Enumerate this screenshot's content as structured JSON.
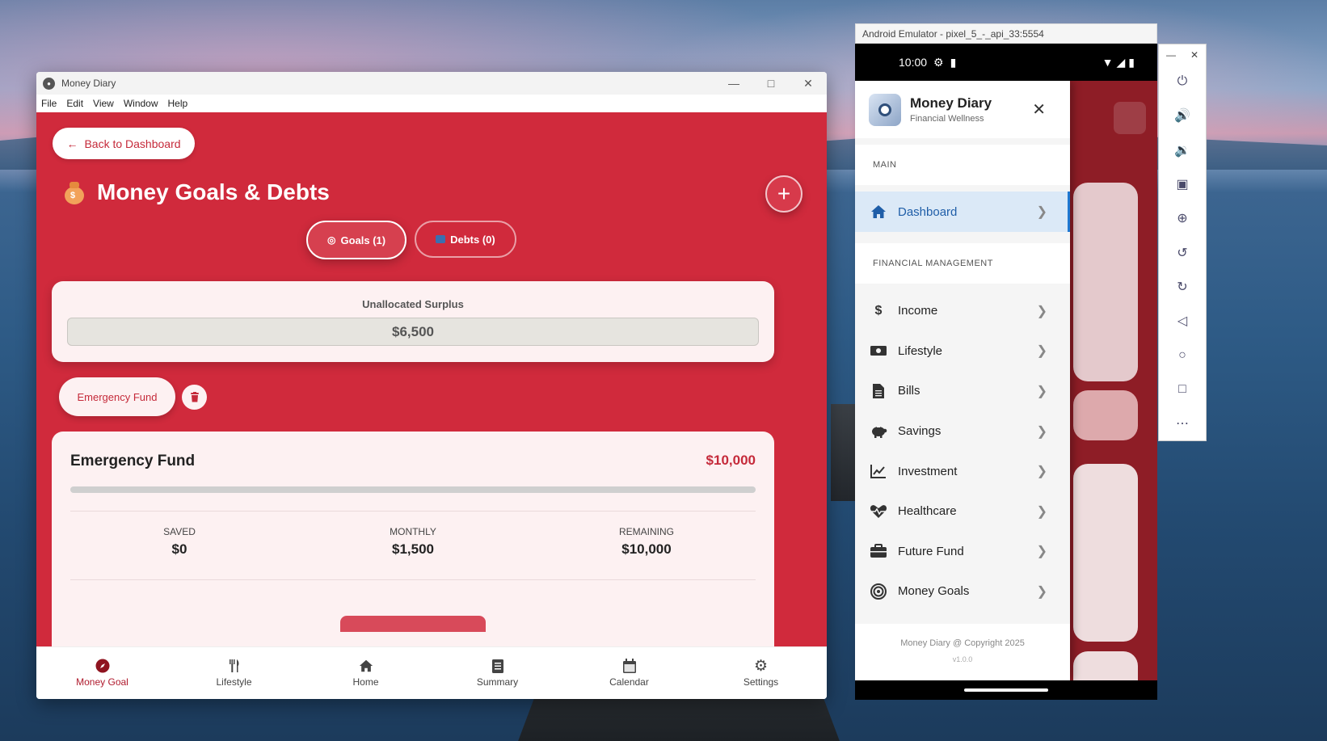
{
  "window": {
    "title": "Money Diary",
    "menu": [
      "File",
      "Edit",
      "View",
      "Window",
      "Help"
    ]
  },
  "page": {
    "back_label": "Back to Dashboard",
    "title": "Money Goals & Debts",
    "tabs": [
      {
        "label": "Goals (1)",
        "active": true,
        "icon": "target-icon"
      },
      {
        "label": "Debts (0)",
        "active": false,
        "icon": "credit-card-icon"
      }
    ],
    "surplus_label": "Unallocated Surplus",
    "surplus_value": "$6,500",
    "goal_chip": "Emergency Fund",
    "goal": {
      "name": "Emergency Fund",
      "target": "$10,000",
      "progress": 0,
      "stats": [
        {
          "label": "SAVED",
          "value": "$0"
        },
        {
          "label": "MONTHLY",
          "value": "$1,500"
        },
        {
          "label": "REMAINING",
          "value": "$10,000"
        }
      ]
    }
  },
  "bottom_nav": [
    {
      "label": "Money Goal",
      "icon": "compass-icon",
      "active": true
    },
    {
      "label": "Lifestyle",
      "icon": "utensils-icon",
      "active": false
    },
    {
      "label": "Home",
      "icon": "home-icon",
      "active": false
    },
    {
      "label": "Summary",
      "icon": "clipboard-icon",
      "active": false
    },
    {
      "label": "Calendar",
      "icon": "calendar-icon",
      "active": false
    },
    {
      "label": "Settings",
      "icon": "gear-icon",
      "active": false
    }
  ],
  "emulator": {
    "title": "Android Emulator - pixel_5_-_api_33:5554",
    "time": "10:00",
    "drawer": {
      "app_name": "Money Diary",
      "subtitle": "Financial Wellness",
      "section_main": "MAIN",
      "dashboard": "Dashboard",
      "section_financial": "FINANCIAL MANAGEMENT",
      "items": [
        {
          "label": "Income",
          "icon": "dollar-icon"
        },
        {
          "label": "Lifestyle",
          "icon": "money-bill-icon"
        },
        {
          "label": "Bills",
          "icon": "file-icon"
        },
        {
          "label": "Savings",
          "icon": "piggy-bank-icon"
        },
        {
          "label": "Investment",
          "icon": "line-chart-icon"
        },
        {
          "label": "Healthcare",
          "icon": "heartbeat-icon"
        },
        {
          "label": "Future Fund",
          "icon": "briefcase-icon"
        },
        {
          "label": "Money Goals",
          "icon": "bullseye-icon"
        }
      ],
      "footer": "Money Diary @ Copyright 2025",
      "version": "v1.0.0"
    }
  },
  "colors": {
    "brand_red": "#d02a3c",
    "accent_blue": "#1f5ea8"
  }
}
